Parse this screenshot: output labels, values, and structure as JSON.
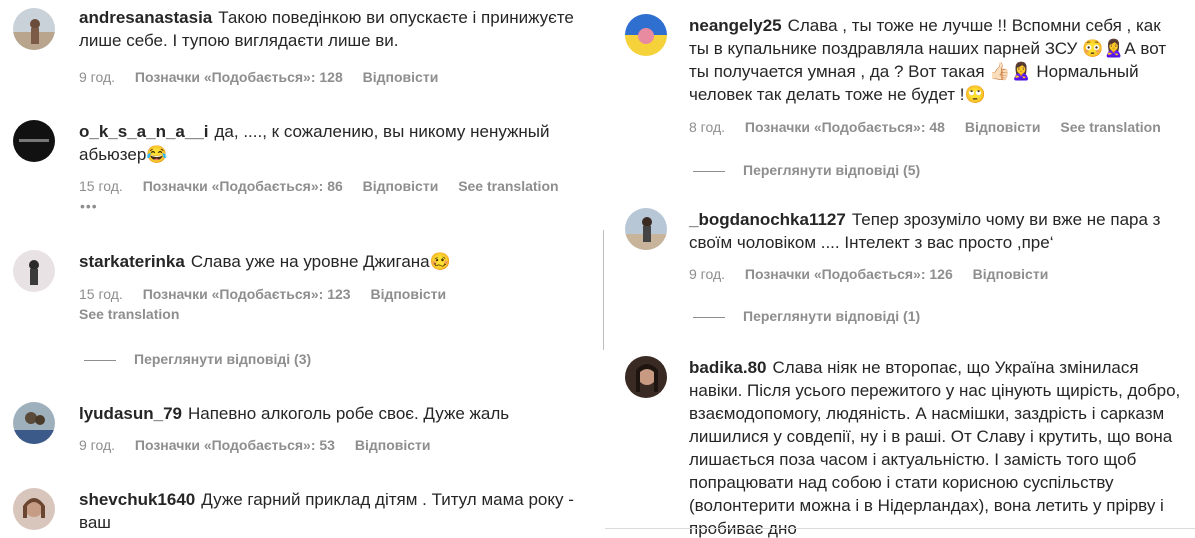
{
  "left": {
    "comments": [
      {
        "user": "andresanastasia",
        "text": "Такою поведінкою ви опускаєте і принижуєте лише себе. І тупою виглядаєти лише ви.",
        "time": "9 год.",
        "likes": "Позначки «Подобається»: 128",
        "reply": "Відповісти"
      },
      {
        "user": "o_k_s_a_n_a__i",
        "text": "да, ...., к сожалению, вы никому ненужный абьюзер😂",
        "time": "15 год.",
        "likes": "Позначки «Подобається»: 86",
        "reply": "Відповісти",
        "see_translation": "See translation",
        "more": "•••"
      },
      {
        "user": "starkaterinka",
        "text": "Слава уже на уровне Джигана🥴",
        "time": "15 год.",
        "likes": "Позначки «Подобається»: 123",
        "reply": "Відповісти",
        "see_translation": "See translation",
        "view_replies": "Переглянути відповіді (3)"
      },
      {
        "user": "lyudasun_79",
        "text": "Напевно алкоголь робе своє. Дуже жаль",
        "time": "9 год.",
        "likes": "Позначки «Подобається»: 53",
        "reply": "Відповісти"
      },
      {
        "user": "shevchuk1640",
        "text": "Дуже гарний приклад дітям . Титул мама року - ваш"
      }
    ]
  },
  "right": {
    "comments": [
      {
        "user": "neangely25",
        "text": "Слава , ты тоже не лучше !! Вспомни себя , как ты в купальнике поздравляла наших парней ЗСУ 😳🙎‍♀️А вот ты получается умная , да ? Вот такая 👍🏻🙎‍♀️ Нормальный человек так делать тоже не будет !🙄",
        "time": "8 год.",
        "likes": "Позначки «Подобається»: 48",
        "reply": "Відповісти",
        "see_translation": "See translation",
        "view_replies": "Переглянути відповіді (5)"
      },
      {
        "user": "_bogdanochka1127",
        "text": "Тепер зрозуміло чому ви вже не пара з своїм чоловіком .... Інтелект з вас просто ,пре‘",
        "time": "9 год.",
        "likes": "Позначки «Подобається»: 126",
        "reply": "Відповісти",
        "view_replies": "Переглянути відповіді (1)"
      },
      {
        "user": "badika.80",
        "text": "Слава ніяк не второпає, що Україна змінилася навіки. Після усього пережитого у нас цінують щирість, добро, взаємодопомогу, людяність. А насмішки, заздрість і сарказм лишилися у совдепії, ну і в раші. От Славу і крутить, що вона лишається поза часом і актуальністю. І замість того щоб попрацювати над собою і стати корисною суспільству (волонтерити можна і в Нідерландах), вона летить у прірву і пробиває дно"
      }
    ]
  },
  "colors": {
    "text": "#262626",
    "meta": "#8e8e8e",
    "background": "#ffffff"
  }
}
